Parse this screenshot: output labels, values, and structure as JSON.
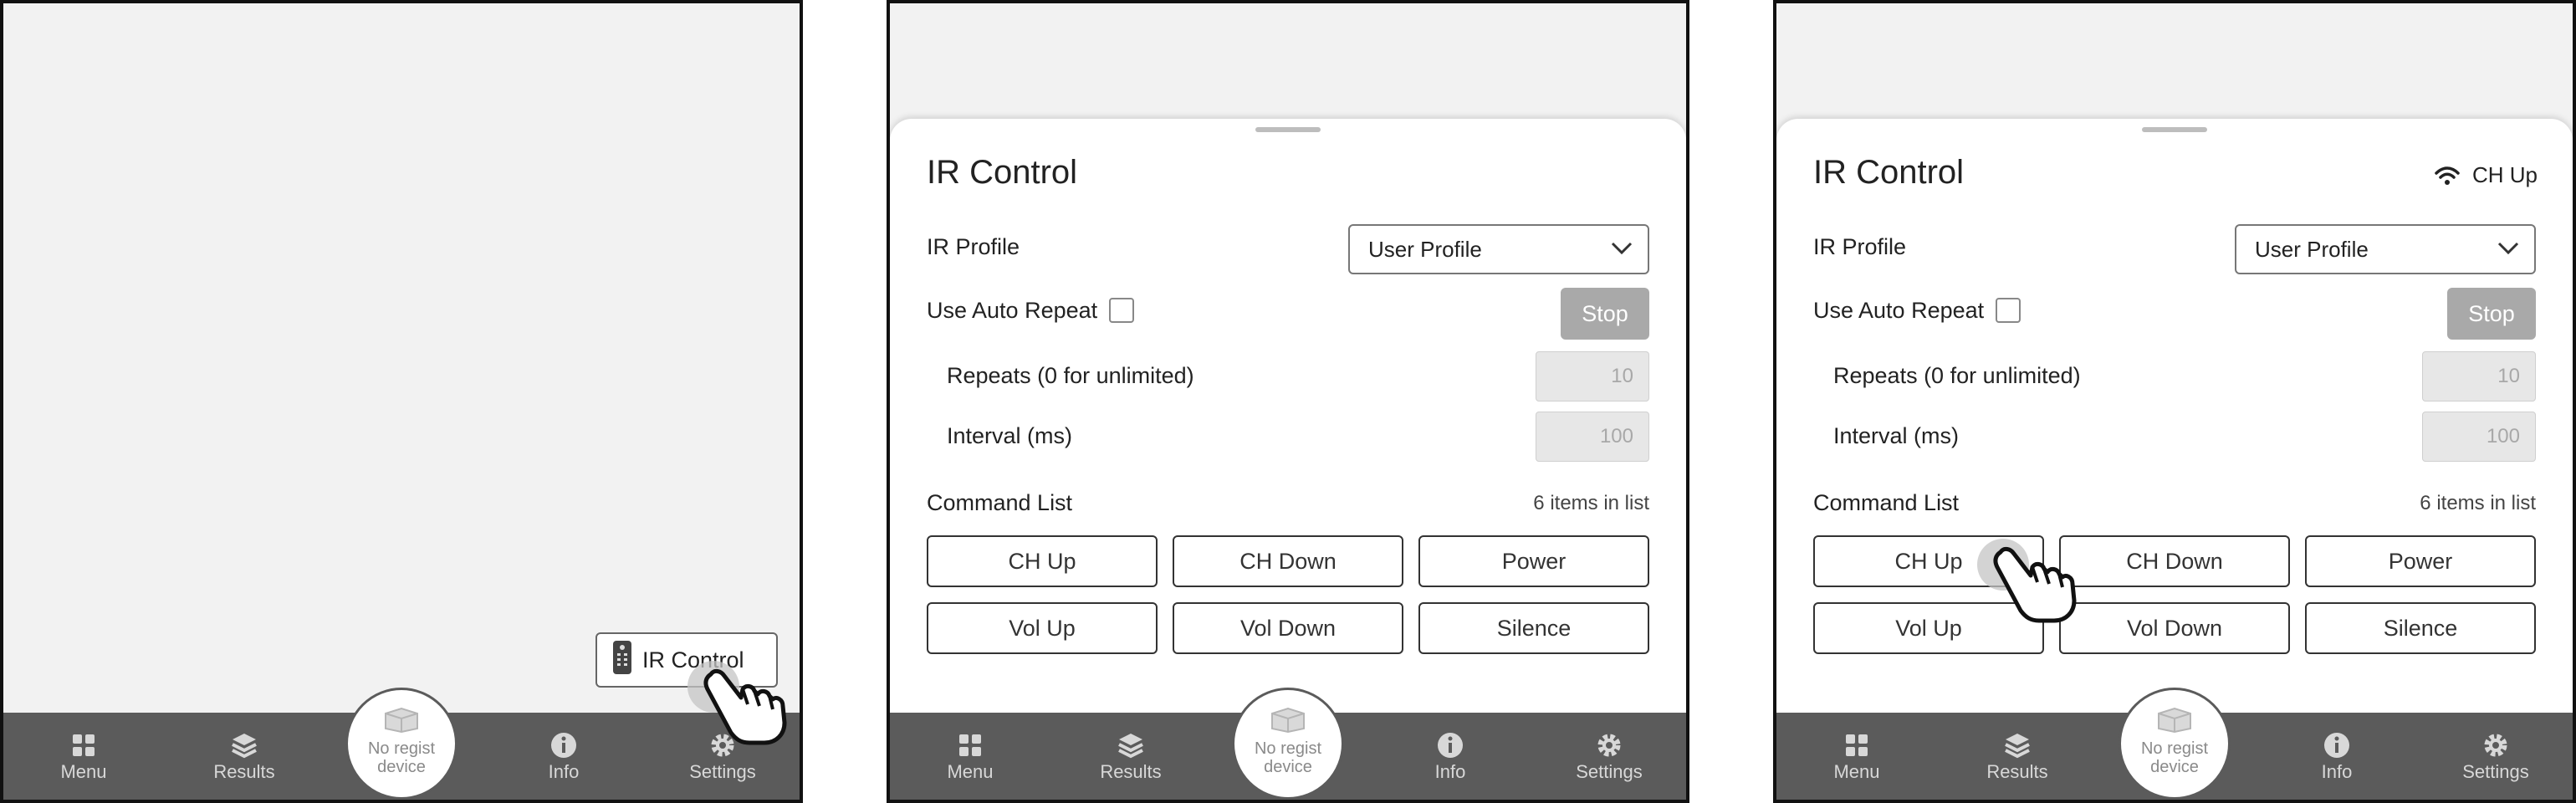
{
  "fab": {
    "label": "IR Control",
    "icon": "remote-icon"
  },
  "sheet": {
    "title": "IR Control",
    "status": {
      "label": "CH Up",
      "icon": "wifi-icon"
    },
    "ir_profile": {
      "label": "IR Profile",
      "value": "User Profile"
    },
    "auto_repeat": {
      "label": "Use Auto Repeat",
      "checked": false,
      "stop_label": "Stop"
    },
    "repeats": {
      "label": "Repeats (0 for unlimited)",
      "value": "10"
    },
    "interval": {
      "label": "Interval (ms)",
      "value": "100"
    },
    "command_list": {
      "label": "Command List",
      "count": "6 items in list",
      "commands": [
        "CH Up",
        "CH Down",
        "Power",
        "Vol Up",
        "Vol Down",
        "Silence"
      ]
    }
  },
  "nav": {
    "items": [
      {
        "label": "Menu",
        "icon": "grid-icon"
      },
      {
        "label": "Results",
        "icon": "layers-icon"
      },
      {
        "label": "Info",
        "icon": "info-icon"
      },
      {
        "label": "Settings",
        "icon": "gear-icon"
      }
    ],
    "center": {
      "label": "No regist device",
      "icon": "box-icon"
    }
  },
  "colors": {
    "nav_bg": "#5b5b5b",
    "stop_button": "#a9a9a9",
    "field_bg": "#e7e7e7"
  }
}
